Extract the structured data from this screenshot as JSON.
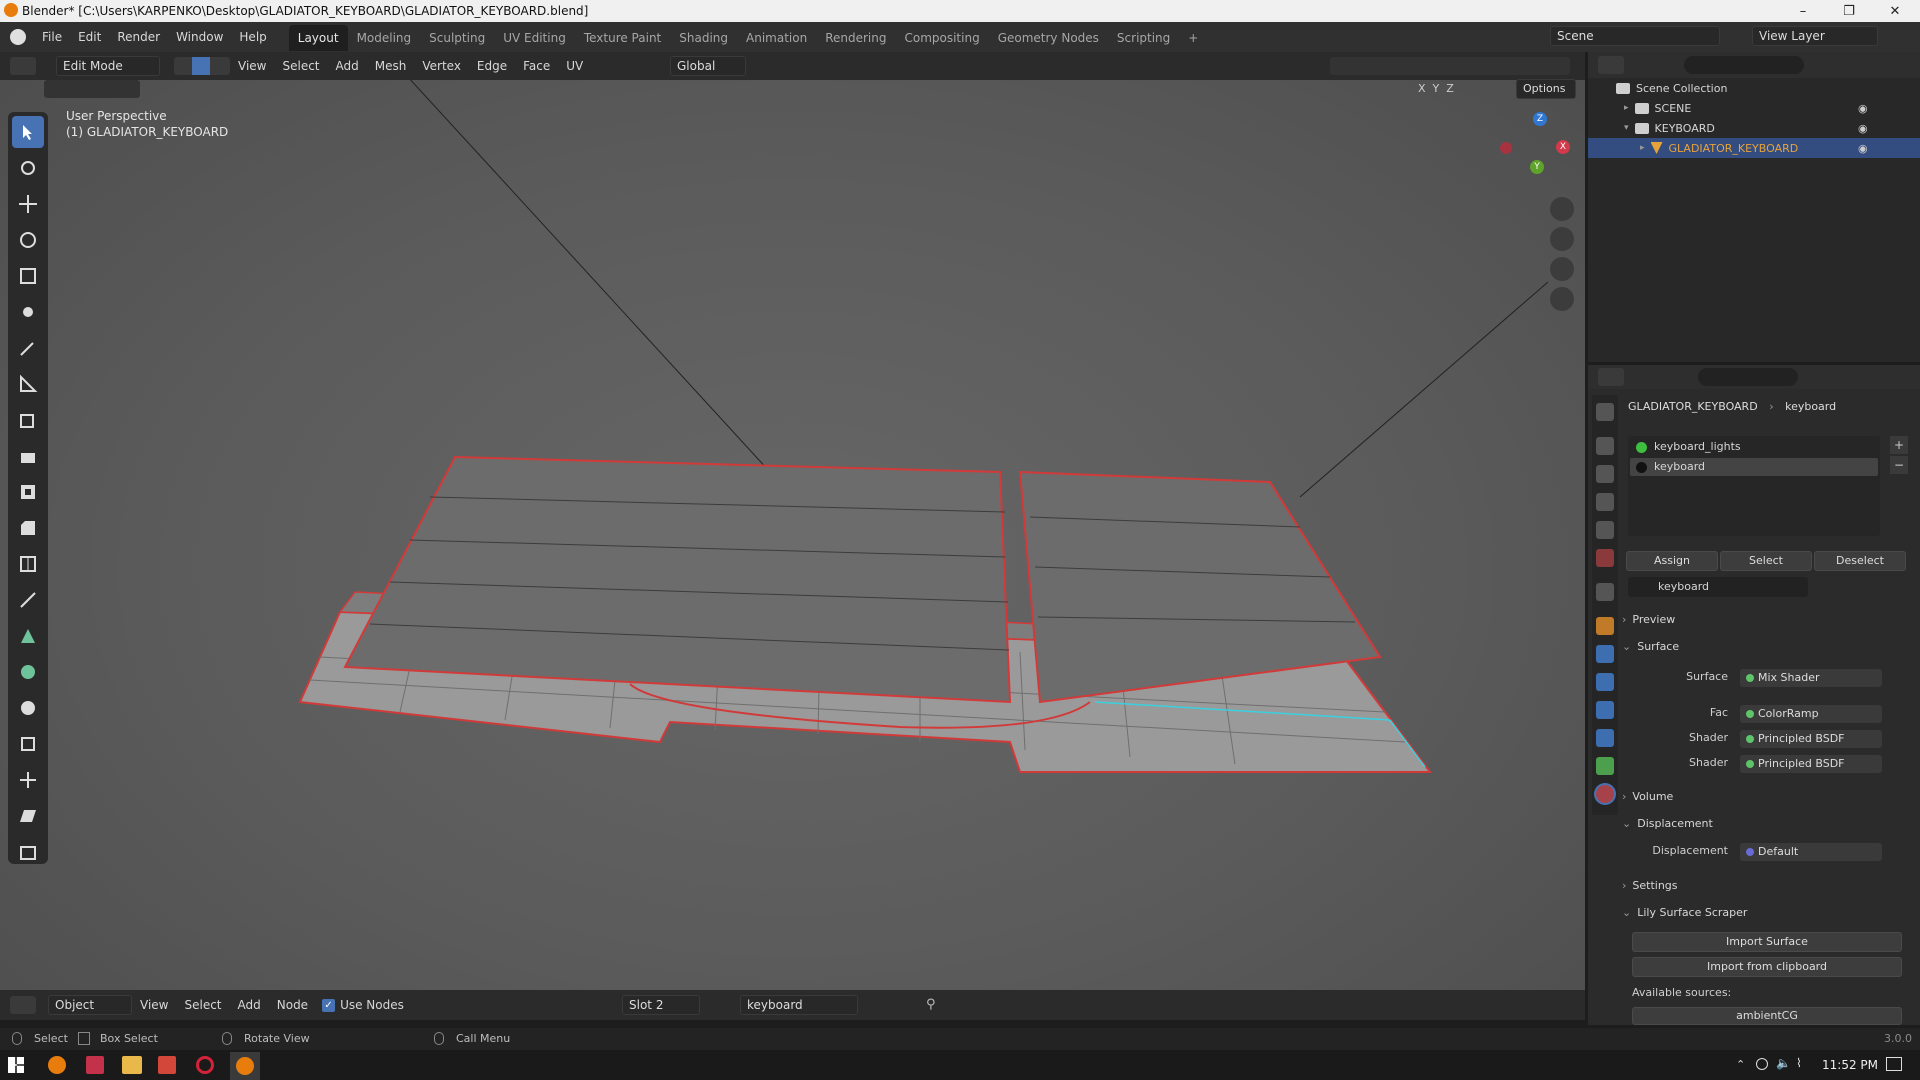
{
  "window": {
    "title": "Blender* [C:\\Users\\KARPENKO\\Desktop\\GLADIATOR_KEYBOARD\\GLADIATOR_KEYBOARD.blend]",
    "minimize": "–",
    "maximize": "❐",
    "close": "✕"
  },
  "menu": [
    "File",
    "Edit",
    "Render",
    "Window",
    "Help"
  ],
  "workspaces": [
    {
      "label": "Layout",
      "active": true
    },
    {
      "label": "Modeling"
    },
    {
      "label": "Sculpting"
    },
    {
      "label": "UV Editing"
    },
    {
      "label": "Texture Paint"
    },
    {
      "label": "Shading"
    },
    {
      "label": "Animation"
    },
    {
      "label": "Rendering"
    },
    {
      "label": "Compositing"
    },
    {
      "label": "Geometry Nodes"
    },
    {
      "label": "Scripting"
    },
    {
      "label": "+"
    }
  ],
  "scene": {
    "label": "Scene",
    "view_layer": "View Layer"
  },
  "viewport_header": {
    "mode": "Edit Mode",
    "menus": [
      "View",
      "Select",
      "Add",
      "Mesh",
      "Vertex",
      "Edge",
      "Face",
      "UV"
    ],
    "orientation": "Global",
    "axes": [
      "X",
      "Y",
      "Z"
    ],
    "options": "Options"
  },
  "viewport": {
    "perspective": "User Perspective",
    "object": "(1) GLADIATOR_KEYBOARD",
    "gizmo_axes": {
      "x": "X",
      "y": "Y",
      "z": "Z"
    }
  },
  "outliner": {
    "root": "Scene Collection",
    "items": [
      {
        "label": "SCENE",
        "indent": 1
      },
      {
        "label": "KEYBOARD",
        "indent": 1
      },
      {
        "label": "GLADIATOR_KEYBOARD",
        "indent": 2,
        "selected": true
      }
    ]
  },
  "properties": {
    "breadcrumb_object": "GLADIATOR_KEYBOARD",
    "breadcrumb_material": "keyboard",
    "material_slots": [
      {
        "label": "keyboard_lights",
        "color": "#3fbf3f"
      },
      {
        "label": "keyboard",
        "color": "#222222",
        "active": true
      }
    ],
    "buttons": {
      "assign": "Assign",
      "select": "Select",
      "deselect": "Deselect"
    },
    "material_name": "keyboard",
    "sections": {
      "preview": "Preview",
      "surface": "Surface",
      "volume": "Volume",
      "displacement": "Displacement",
      "settings": "Settings",
      "lily": "Lily Surface Scraper"
    },
    "surface_rows": [
      {
        "label": "Surface",
        "value": "Mix Shader"
      },
      {
        "label": "Fac",
        "value": "ColorRamp"
      },
      {
        "label": "Shader",
        "value": "Principled BSDF"
      },
      {
        "label": "Shader",
        "value": "Principled BSDF"
      }
    ],
    "displacement_row": {
      "label": "Displacement",
      "value": "Default"
    },
    "lily": {
      "import_surface": "Import Surface",
      "import_clipboard": "Import from clipboard",
      "available": "Available sources:",
      "source": "ambientCG"
    }
  },
  "node_header": {
    "mode": "Object",
    "menus": [
      "View",
      "Select",
      "Add",
      "Node"
    ],
    "use_nodes": "Use Nodes",
    "slot": "Slot 2",
    "material": "keyboard"
  },
  "status": {
    "select": "Select",
    "box_select": "Box Select",
    "rotate": "Rotate View",
    "call_menu": "Call Menu",
    "version": "3.0.0"
  },
  "taskbar": {
    "time": "11:52 PM"
  },
  "colors": {
    "accent": "#4772b3",
    "selected_object": "#e8a23a",
    "edge_red": "#d23a3a",
    "edge_cyan": "#3ad0e0"
  }
}
